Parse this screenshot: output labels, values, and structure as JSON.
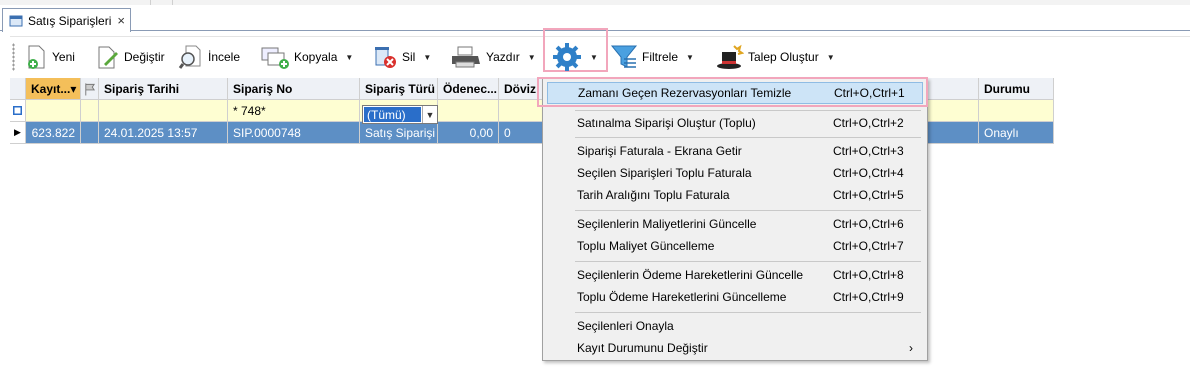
{
  "tab": {
    "title": "Satış Siparişleri",
    "close": "×"
  },
  "toolbar": {
    "new": "Yeni",
    "edit": "Değiştir",
    "view": "İncele",
    "copy": "Kopyala",
    "delete": "Sil",
    "print": "Yazdır",
    "filter": "Filtrele",
    "request": "Talep Oluştur",
    "arrow": "▼"
  },
  "grid": {
    "columns": [
      "Kayıt...",
      "",
      "Sipariş Tarihi",
      "Sipariş No",
      "Sipariş Türü",
      "Ödenec...",
      "Döviz",
      "Durumu"
    ],
    "sort_arrow": "▾",
    "filter_row": {
      "order_no": "* 748*",
      "order_type": "(Tümü)"
    },
    "rows": [
      {
        "indicator": "▶",
        "record": "623.822",
        "flag": "",
        "date": "24.01.2025 13:57",
        "order_no": "SIP.0000748",
        "type": "Satış Siparişi",
        "amount": "0,00",
        "currency": "0",
        "status": "Onaylı"
      }
    ]
  },
  "context_menu": {
    "items": [
      {
        "label": "Zamanı Geçen Rezervasyonları Temizle",
        "shortcut": "Ctrl+O,Ctrl+1"
      },
      {
        "label": "Satınalma Siparişi Oluştur (Toplu)",
        "shortcut": "Ctrl+O,Ctrl+2"
      },
      {
        "label": "Siparişi Faturala - Ekrana Getir",
        "shortcut": "Ctrl+O,Ctrl+3"
      },
      {
        "label": "Seçilen Siparişleri Toplu Faturala",
        "shortcut": "Ctrl+O,Ctrl+4"
      },
      {
        "label": "Tarih Aralığını Toplu Faturala",
        "shortcut": "Ctrl+O,Ctrl+5"
      },
      {
        "label": "Seçilenlerin Maliyetlerini Güncelle",
        "shortcut": "Ctrl+O,Ctrl+6"
      },
      {
        "label": "Toplu Maliyet Güncelleme",
        "shortcut": "Ctrl+O,Ctrl+7"
      },
      {
        "label": "Seçilenlerin Ödeme Hareketlerini Güncelle",
        "shortcut": "Ctrl+O,Ctrl+8"
      },
      {
        "label": "Toplu Ödeme Hareketlerini Güncelleme",
        "shortcut": "Ctrl+O,Ctrl+9"
      },
      {
        "label": "Seçilenleri Onayla",
        "shortcut": ""
      },
      {
        "label": "Kayıt Durumunu Değiştir",
        "shortcut": "",
        "submenu": "›"
      }
    ]
  },
  "colors": {
    "header_active": "#f4bf5a",
    "selected_row": "#5d8fc5",
    "filter_row": "#fefed2",
    "menu_hot": "#cde4f7",
    "highlight_box": "#f2a6bc"
  }
}
